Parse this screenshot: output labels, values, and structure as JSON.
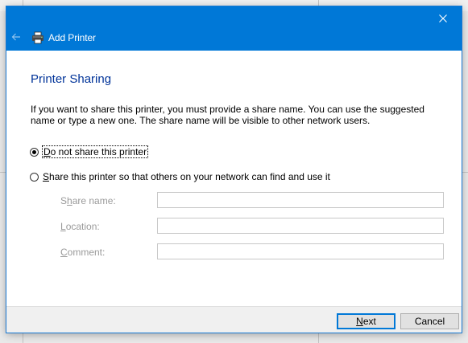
{
  "dialog": {
    "title": "Add Printer",
    "close_glyph": "✕",
    "back_glyph": "←",
    "accent_color": "#0078d7"
  },
  "content": {
    "heading": "Printer Sharing",
    "description": "If you want to share this printer, you must provide a share name. You can use the suggested name or type a new one. The share name will be visible to other network users.",
    "options": [
      {
        "label_mnemonic": "D",
        "label_rest": "o not share this printer",
        "checked": true
      },
      {
        "label_mnemonic": "S",
        "label_rest": "hare this printer so that others on your network can find and use it",
        "checked": false
      }
    ],
    "fields": {
      "share_name": {
        "label_pre": "S",
        "label_mnemonic": "h",
        "label_rest": "are name:",
        "value": ""
      },
      "location": {
        "label_pre": "",
        "label_mnemonic": "L",
        "label_rest": "ocation:",
        "value": ""
      },
      "comment": {
        "label_pre": "",
        "label_mnemonic": "C",
        "label_rest": "omment:",
        "value": ""
      }
    }
  },
  "footer": {
    "next_mnemonic": "N",
    "next_rest": "ext",
    "cancel_label": "Cancel"
  }
}
